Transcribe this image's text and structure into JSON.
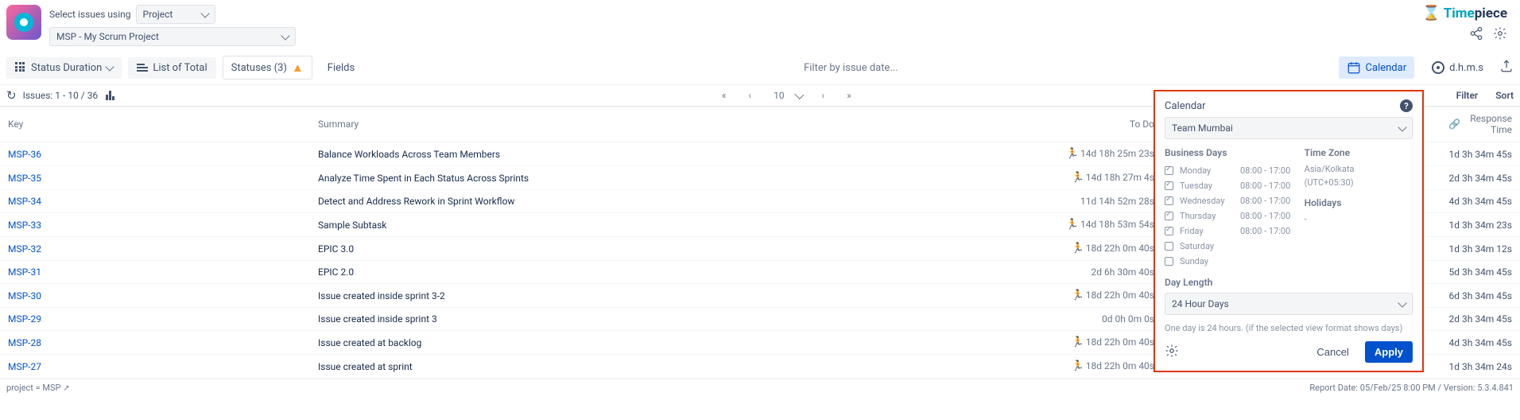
{
  "header": {
    "selectLabel": "Select issues using",
    "selectorValue": "Project",
    "projectValue": "MSP - My Scrum Project",
    "brand1": "Time",
    "brand2": "piece"
  },
  "toolbar": {
    "statusDuration": "Status Duration",
    "listOfTotal": "List of Total",
    "statuses": "Statuses (3)",
    "fields": "Fields",
    "filterBy": "Filter by issue date...",
    "calendar": "Calendar",
    "dhms": "d.h.m.s"
  },
  "subbar": {
    "issues": "Issues: 1 - 10 / 36",
    "pageSize": "10",
    "filter": "Filter",
    "sort": "Sort"
  },
  "columns": {
    "key": "Key",
    "summary": "Summary",
    "todo": "To Do",
    "responseTime": "Response Time"
  },
  "rows": [
    {
      "key": "MSP-36",
      "summary": "Balance Workloads Across Team Members",
      "todo": "14d 18h 25m 23s",
      "run": true,
      "rt": "1d 3h 34m 45s"
    },
    {
      "key": "MSP-35",
      "summary": "Analyze Time Spent in Each Status Across Sprints",
      "todo": "14d 18h 27m 4s",
      "run": true,
      "rt": "2d 3h 34m 45s"
    },
    {
      "key": "MSP-34",
      "summary": "Detect and Address Rework in Sprint Workflow",
      "todo": "11d 14h 52m 28s",
      "run": false,
      "rt": "4d 3h 34m 45s"
    },
    {
      "key": "MSP-33",
      "summary": "Sample Subtask",
      "todo": "14d 18h 53m 54s",
      "run": true,
      "rt": "1d 3h 34m 23s"
    },
    {
      "key": "MSP-32",
      "summary": "EPIC 3.0",
      "todo": "18d 22h 0m 40s",
      "run": true,
      "rt": "1d 3h 34m 12s"
    },
    {
      "key": "MSP-31",
      "summary": "EPIC 2.0",
      "todo": "2d 6h 30m 40s",
      "run": false,
      "rt": "5d 3h 34m 45s"
    },
    {
      "key": "MSP-30",
      "summary": "Issue created inside sprint 3-2",
      "todo": "18d 22h 0m 40s",
      "run": true,
      "rt": "6d 3h 34m 45s"
    },
    {
      "key": "MSP-29",
      "summary": "Issue created inside sprint 3",
      "todo": "0d 0h 0m 0s",
      "run": false,
      "rt": "2d 3h 34m 45s"
    },
    {
      "key": "MSP-28",
      "summary": "Issue created at backlog",
      "todo": "18d 22h 0m 40s",
      "run": true,
      "rt": "4d 3h 34m 45s"
    },
    {
      "key": "MSP-27",
      "summary": "Issue created at sprint",
      "todo": "18d 22h 0m 40s",
      "run": true,
      "rt": "1d 3h 34m 24s"
    }
  ],
  "calendar": {
    "title": "Calendar",
    "team": "Team Mumbai",
    "businessDaysLabel": "Business Days",
    "timeZoneLabel": "Time Zone",
    "tzName": "Asia/Kolkata",
    "tzOffset": "(UTC+05:30)",
    "holidaysLabel": "Holidays",
    "holidaysValue": "-",
    "days": [
      {
        "name": "Monday",
        "checked": true,
        "hours": "08:00 - 17:00"
      },
      {
        "name": "Tuesday",
        "checked": true,
        "hours": "08:00 - 17:00"
      },
      {
        "name": "Wednesday",
        "checked": true,
        "hours": "08:00 - 17:00"
      },
      {
        "name": "Thursday",
        "checked": true,
        "hours": "08:00 - 17:00"
      },
      {
        "name": "Friday",
        "checked": true,
        "hours": "08:00 - 17:00"
      },
      {
        "name": "Saturday",
        "checked": false,
        "hours": ""
      },
      {
        "name": "Sunday",
        "checked": false,
        "hours": ""
      }
    ],
    "dayLengthLabel": "Day Length",
    "dayLengthValue": "24 Hour Days",
    "hint": "One day is 24 hours. (if the selected view format shows days)",
    "cancel": "Cancel",
    "apply": "Apply"
  },
  "footer": {
    "jql": "project = MSP",
    "report": "Report Date: 05/Feb/25 8:00 PM / Version: 5.3.4.841"
  }
}
